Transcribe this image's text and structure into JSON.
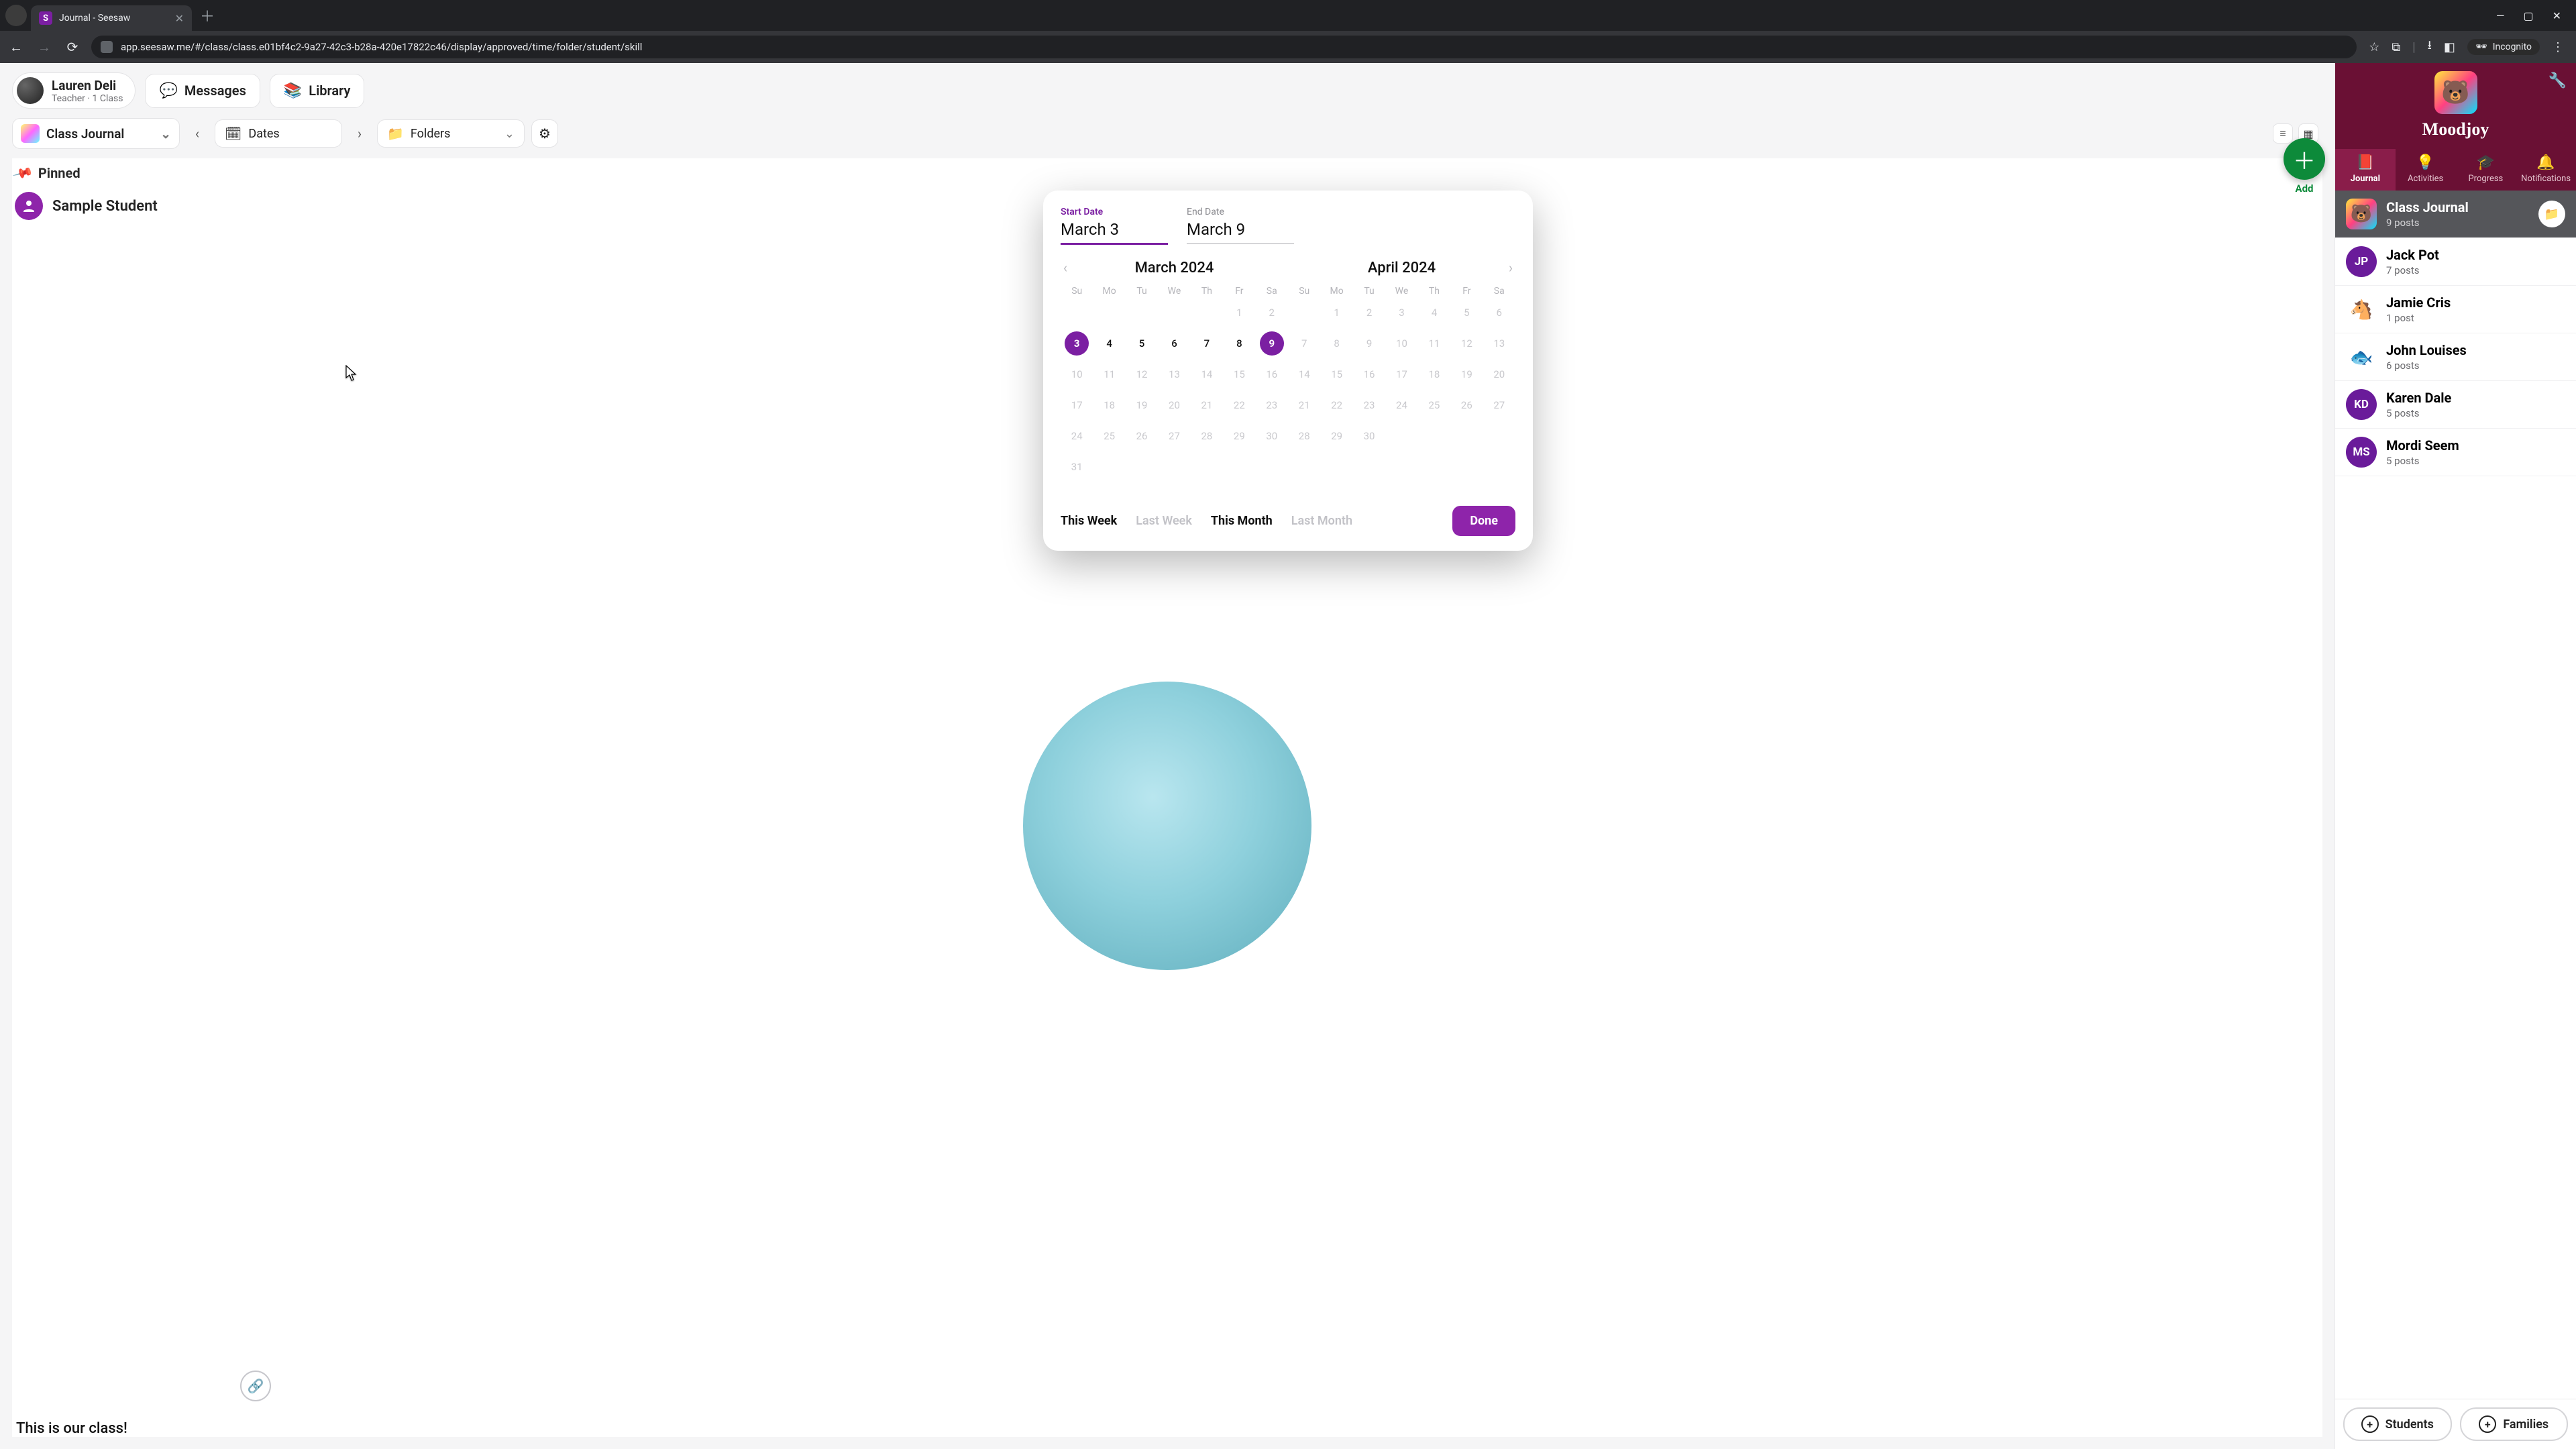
{
  "browser": {
    "tab_title": "Journal - Seesaw",
    "url": "app.seesaw.me/#/class/class.e01bf4c2-9a27-42c3-b28a-420e17822c46/display/approved/time/folder/student/skill",
    "incognito_label": "Incognito"
  },
  "header": {
    "user_name": "Lauren Deli",
    "user_role": "Teacher · 1 Class",
    "messages_label": "Messages",
    "library_label": "Library",
    "add_label": "Add"
  },
  "filters": {
    "journal_select": "Class Journal",
    "dates_label": "Dates",
    "folders_label": "Folders"
  },
  "feed": {
    "pinned_label": "Pinned",
    "student_name": "Sample Student",
    "caption": "This is our class!"
  },
  "sidebar": {
    "class_name": "Moodjoy",
    "tabs": {
      "journal": "Journal",
      "activities": "Activities",
      "progress": "Progress",
      "notifications": "Notifications"
    },
    "items": [
      {
        "title": "Class Journal",
        "sub": "9 posts",
        "avatar_type": "rainbow",
        "initials": "",
        "color": ""
      },
      {
        "title": "Jack Pot",
        "sub": "7 posts",
        "avatar_type": "initials",
        "initials": "JP",
        "color": "#6a1b9a"
      },
      {
        "title": "Jamie Cris",
        "sub": "1 post",
        "avatar_type": "emoji",
        "initials": "🐴",
        "color": "#fff"
      },
      {
        "title": "John Louises",
        "sub": "6 posts",
        "avatar_type": "emoji",
        "initials": "🐟",
        "color": "#fff"
      },
      {
        "title": "Karen Dale",
        "sub": "5 posts",
        "avatar_type": "initials",
        "initials": "KD",
        "color": "#6a1b9a"
      },
      {
        "title": "Mordi Seem",
        "sub": "5 posts",
        "avatar_type": "initials",
        "initials": "MS",
        "color": "#6a1b9a"
      }
    ],
    "students_btn": "Students",
    "families_btn": "Families"
  },
  "datepicker": {
    "start_label": "Start Date",
    "start_value": "March 3",
    "end_label": "End Date",
    "end_value": "March 9",
    "month1_title": "March 2024",
    "month2_title": "April 2024",
    "weekdays": [
      "Su",
      "Mo",
      "Tu",
      "We",
      "Th",
      "Fr",
      "Sa"
    ],
    "march_grid": [
      [
        "",
        "",
        "",
        "",
        "",
        "1",
        "2"
      ],
      [
        "3",
        "4",
        "5",
        "6",
        "7",
        "8",
        "9"
      ],
      [
        "10",
        "11",
        "12",
        "13",
        "14",
        "15",
        "16"
      ],
      [
        "17",
        "18",
        "19",
        "20",
        "21",
        "22",
        "23"
      ],
      [
        "24",
        "25",
        "26",
        "27",
        "28",
        "29",
        "30"
      ],
      [
        "31",
        "",
        "",
        "",
        "",
        "",
        ""
      ]
    ],
    "march_selected": [
      "3",
      "9"
    ],
    "march_active_range": [
      "3",
      "4",
      "5",
      "6",
      "7",
      "8",
      "9"
    ],
    "april_grid": [
      [
        "",
        "1",
        "2",
        "3",
        "4",
        "5",
        "6"
      ],
      [
        "7",
        "8",
        "9",
        "10",
        "11",
        "12",
        "13"
      ],
      [
        "14",
        "15",
        "16",
        "17",
        "18",
        "19",
        "20"
      ],
      [
        "21",
        "22",
        "23",
        "24",
        "25",
        "26",
        "27"
      ],
      [
        "28",
        "29",
        "30",
        "",
        "",
        "",
        ""
      ]
    ],
    "quick": {
      "this_week": "This Week",
      "last_week": "Last Week",
      "this_month": "This Month",
      "last_month": "Last Month"
    },
    "done": "Done"
  }
}
